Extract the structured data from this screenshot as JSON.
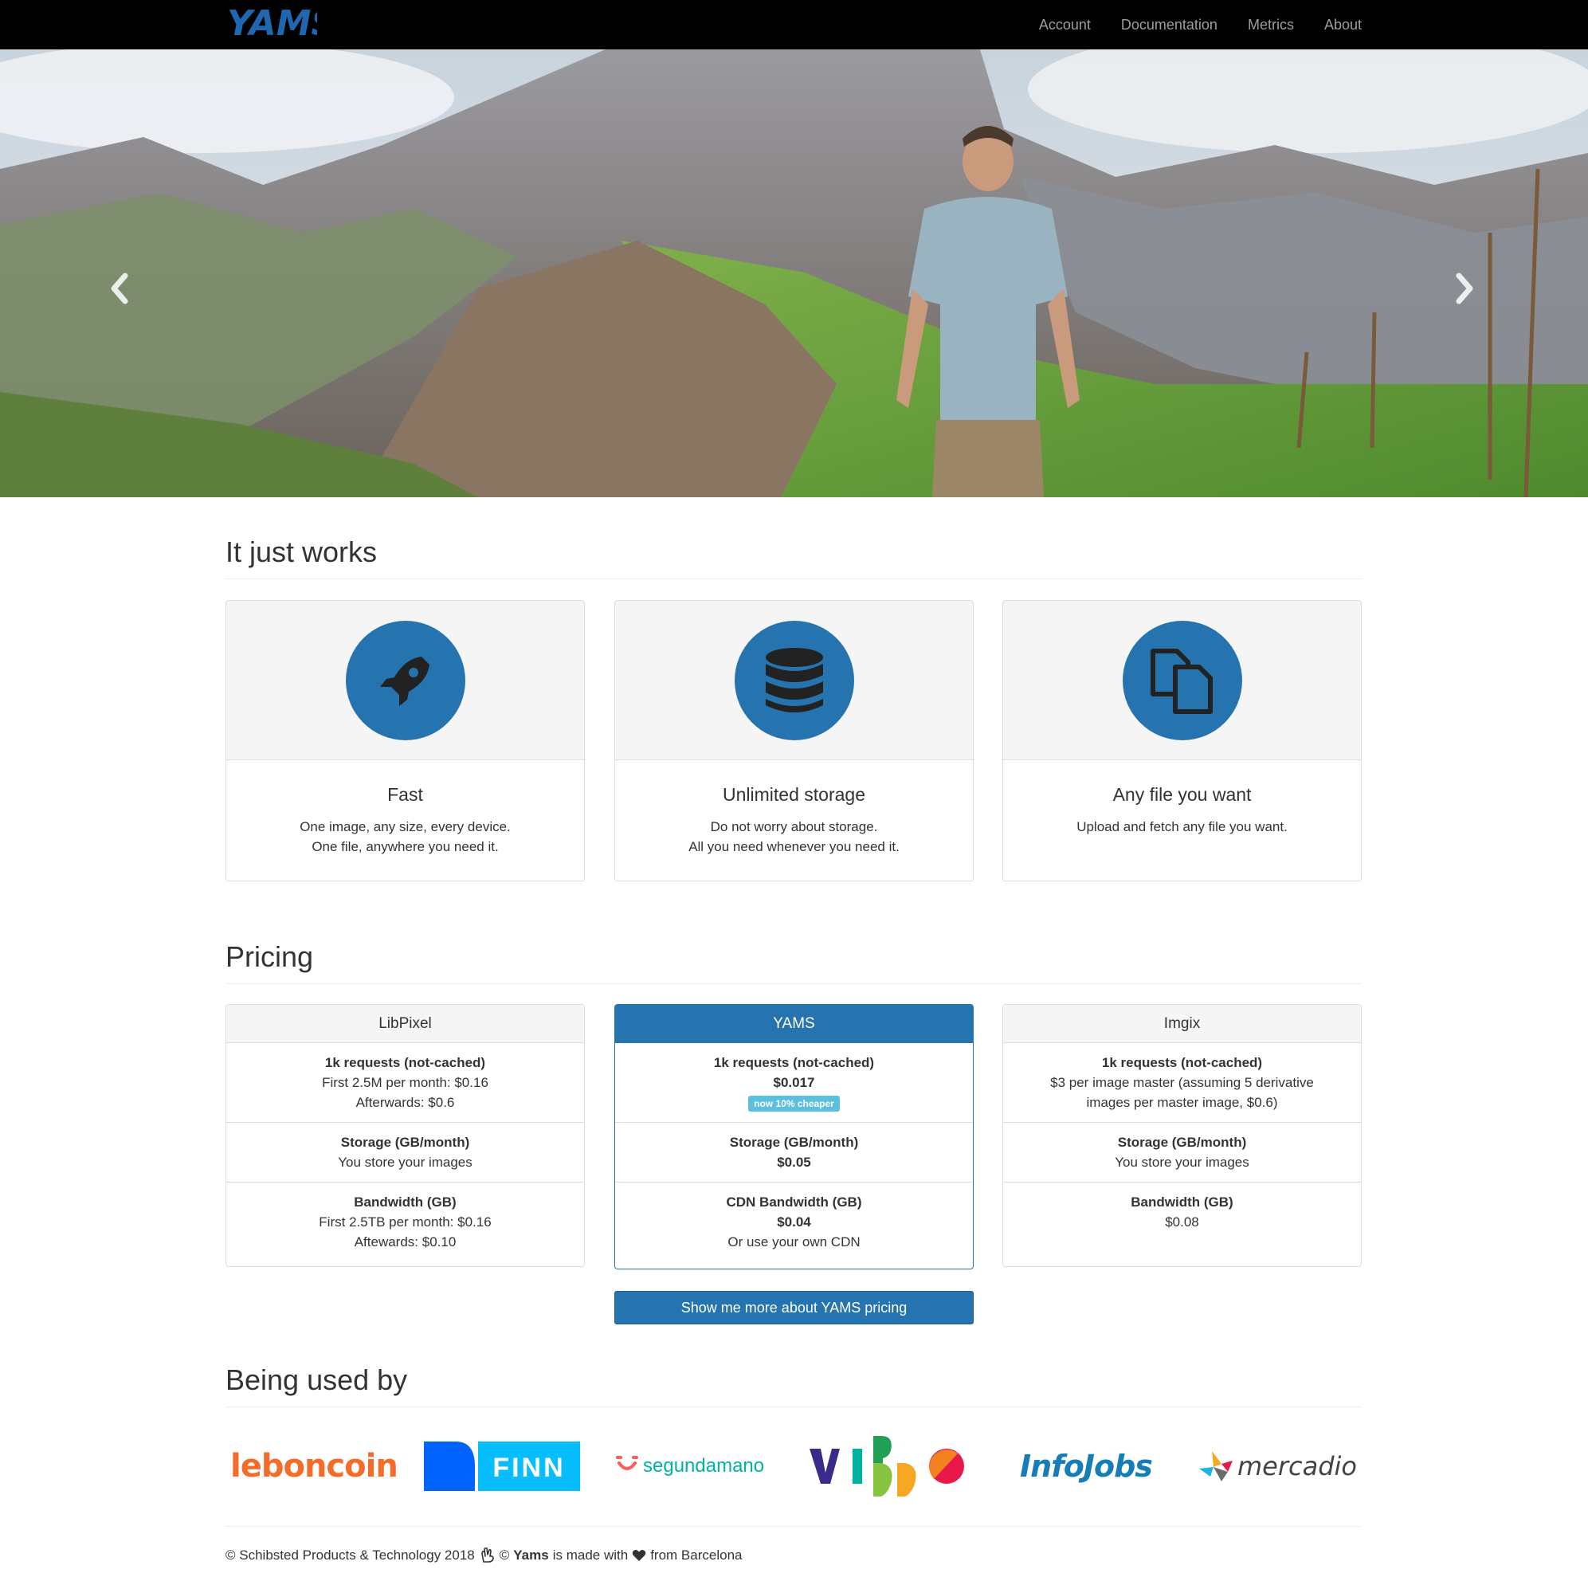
{
  "nav": {
    "brand": "YAMS",
    "links": [
      "Account",
      "Documentation",
      "Metrics",
      "About"
    ]
  },
  "hero": {
    "prev_icon": "chevron-left-icon",
    "next_icon": "chevron-right-icon"
  },
  "features": {
    "title": "It just works",
    "items": [
      {
        "icon": "rocket-icon",
        "title": "Fast",
        "line1": "One image, any size, every device.",
        "line2": "One file, anywhere you need it."
      },
      {
        "icon": "database-icon",
        "title": "Unlimited storage",
        "line1": "Do not worry about storage.",
        "line2": "All you need whenever you need it."
      },
      {
        "icon": "copy-files-icon",
        "title": "Any file you want",
        "line1": "Upload and fetch any file you want.",
        "line2": ""
      }
    ]
  },
  "pricing": {
    "title": "Pricing",
    "libpixel": {
      "name": "LibPixel",
      "req_label": "1k requests (not-cached)",
      "req_line1": "First 2.5M per month: $0.16",
      "req_line2": "Afterwards: $0.6",
      "storage_label": "Storage (GB/month)",
      "storage_value": "You store your images",
      "bw_label": "Bandwidth (GB)",
      "bw_line1": "First 2.5TB per month: $0.16",
      "bw_line2": "Aftewards: $0.10"
    },
    "yams": {
      "name": "YAMS",
      "req_label": "1k requests (not-cached)",
      "req_value": "$0.017",
      "badge": "now 10% cheaper",
      "storage_label": "Storage (GB/month)",
      "storage_value": "$0.05",
      "bw_label": "CDN Bandwidth (GB)",
      "bw_value": "$0.04",
      "bw_note": "Or use your own CDN"
    },
    "imgix": {
      "name": "Imgix",
      "req_label": "1k requests (not-cached)",
      "req_line1": "$3 per image master (assuming 5 derivative",
      "req_line2": "images per master image, $0.6)",
      "storage_label": "Storage (GB/month)",
      "storage_value": "You store your images",
      "bw_label": "Bandwidth (GB)",
      "bw_value": "$0.08"
    },
    "more_button": "Show me more about YAMS pricing"
  },
  "used_by": {
    "title": "Being used by",
    "logos": {
      "leboncoin": "leboncoin",
      "finn": "FINN",
      "segundamano": "segundamano",
      "infojobs": "InfoJobs",
      "mercadio": "mercadio"
    }
  },
  "footer": {
    "copyright": "© Schibsted Products & Technology 2018",
    "copy2": "©",
    "brand": "Yams",
    "made_with": "is made with",
    "from": "from Barcelona"
  },
  "colors": {
    "primary": "#2573af",
    "badge": "#5bc0de",
    "navbar": "#000000"
  }
}
